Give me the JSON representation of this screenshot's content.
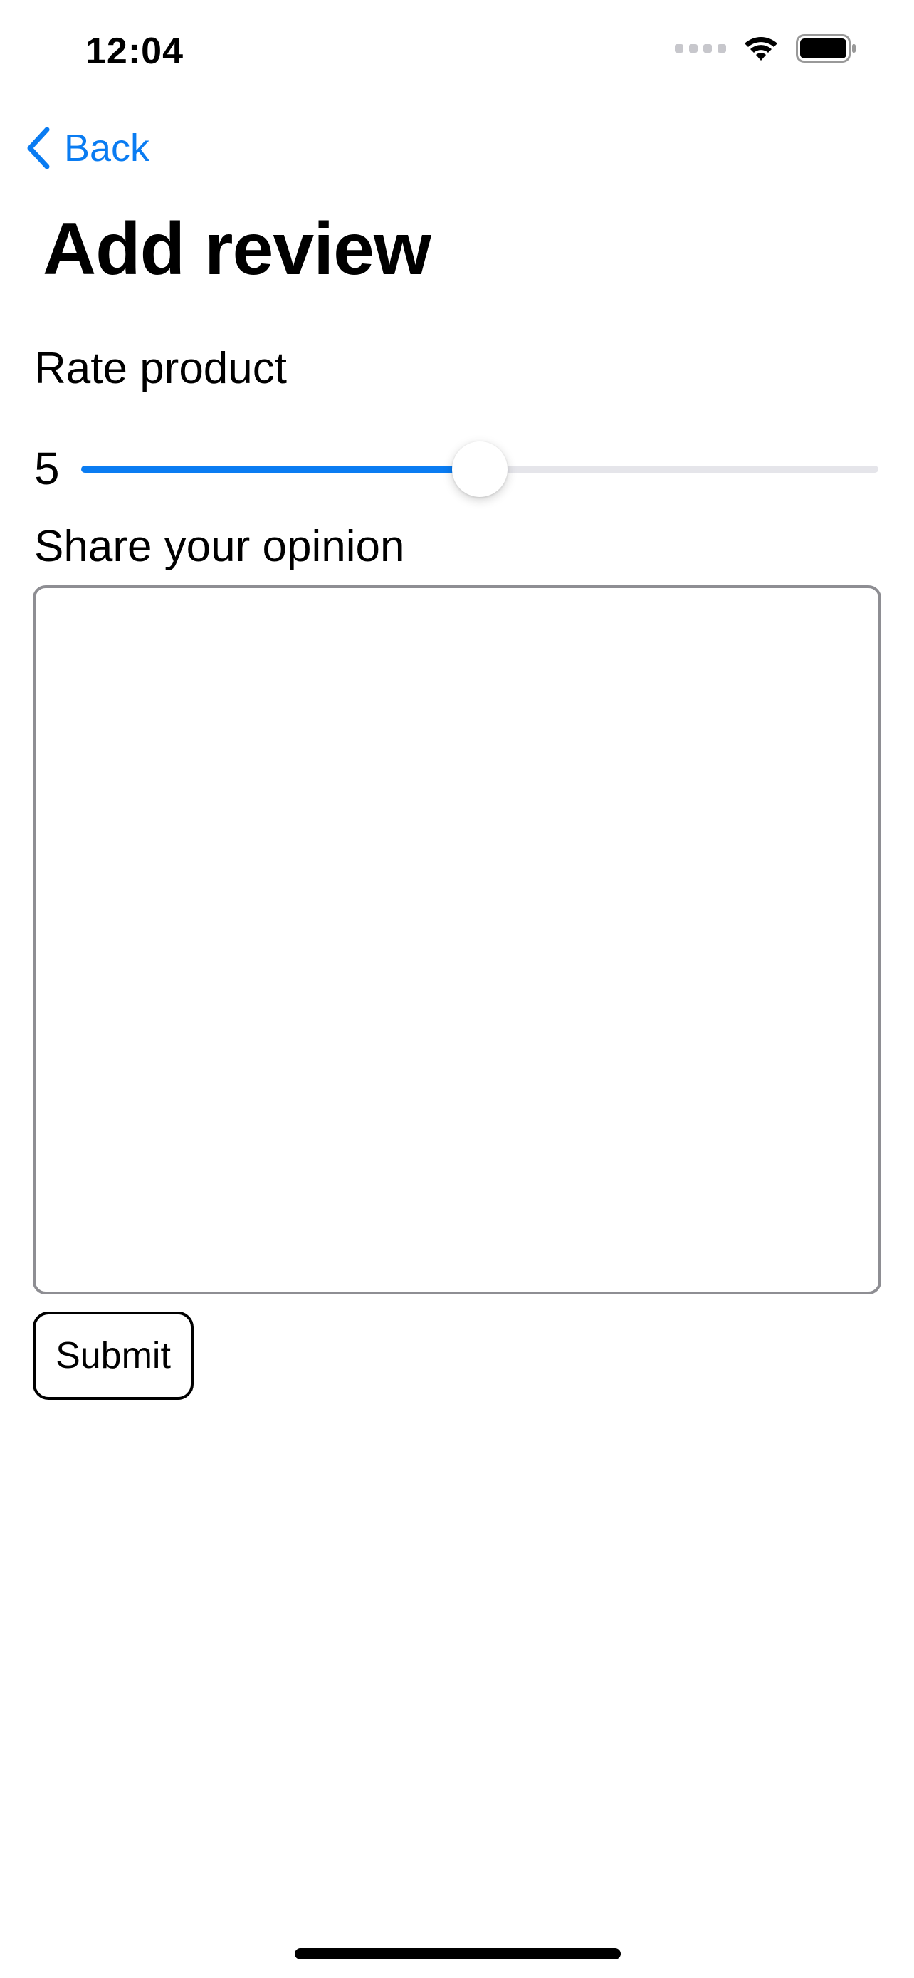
{
  "status_bar": {
    "time": "12:04",
    "icons": [
      "cellular-signal-icon",
      "wifi-icon",
      "battery-icon"
    ]
  },
  "nav": {
    "back_label": "Back",
    "back_icon": "chevron-left-icon"
  },
  "page": {
    "title": "Add review"
  },
  "rating": {
    "label": "Rate product",
    "value": "5",
    "fill_fraction": 0.5
  },
  "opinion": {
    "label": "Share your opinion",
    "value": ""
  },
  "submit": {
    "label": "Submit"
  },
  "colors": {
    "accent": "#0a7cf2",
    "track": "#e5e5ea",
    "border": "#8e8e93"
  }
}
